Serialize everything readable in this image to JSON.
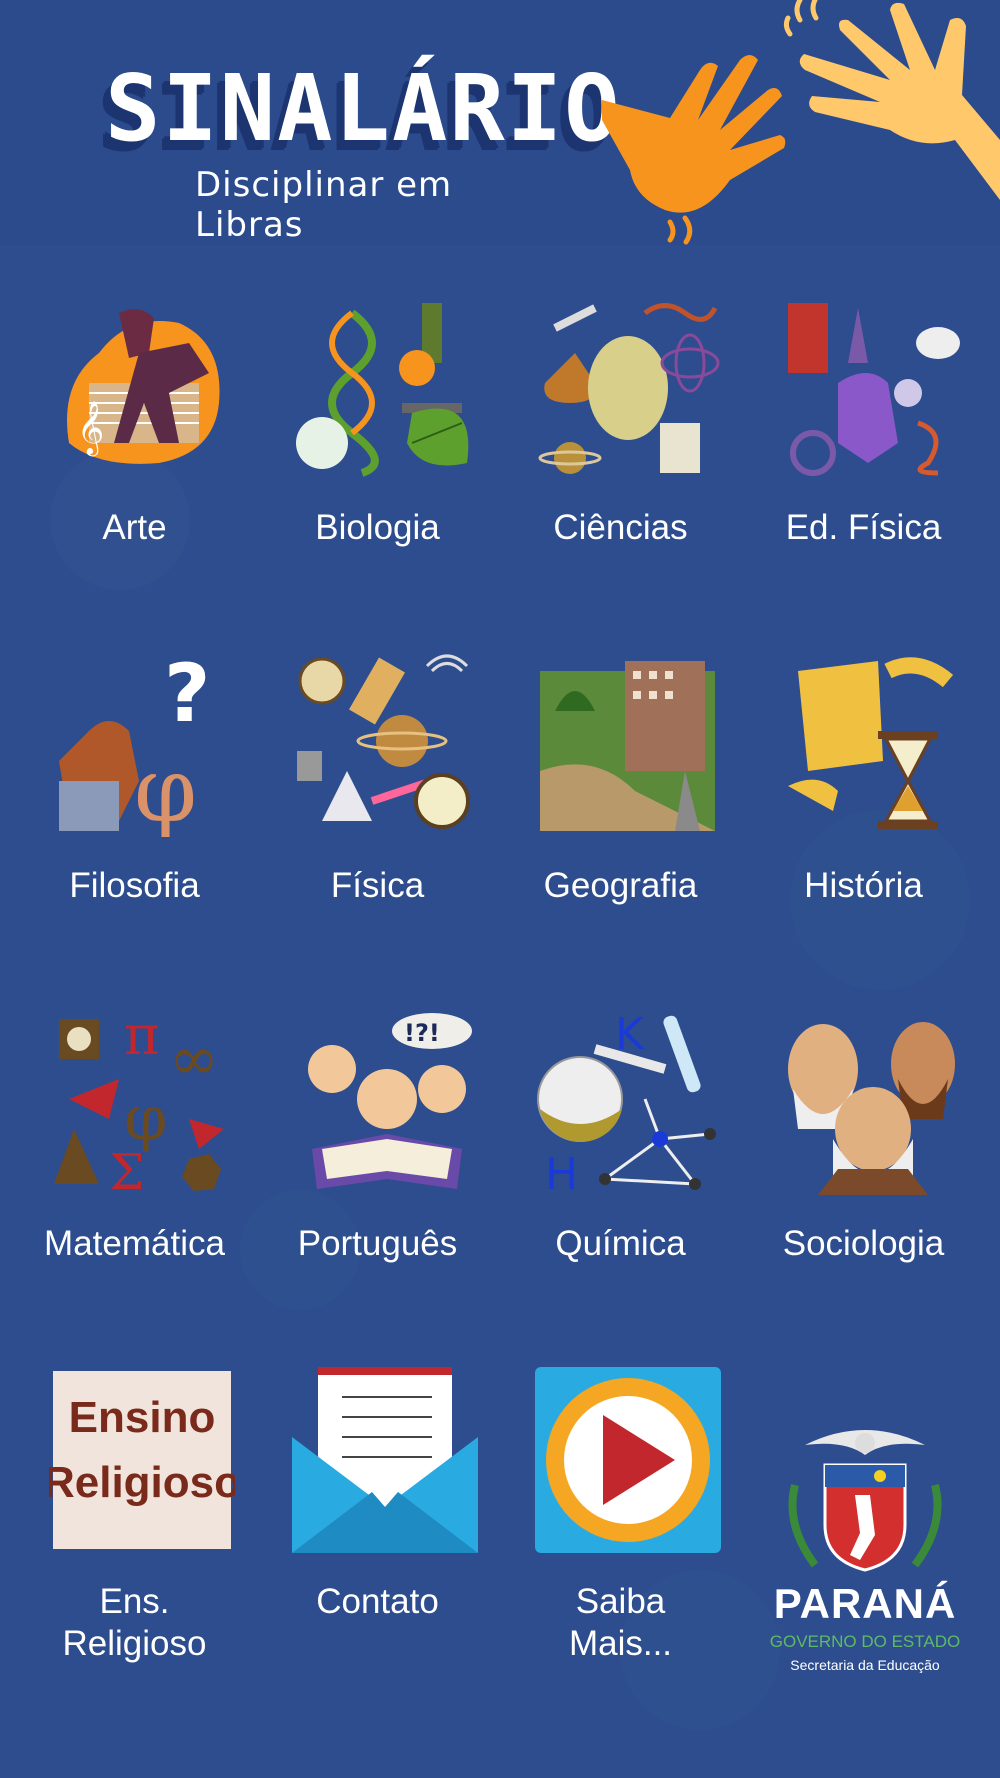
{
  "header": {
    "logo_title": "SINALÁRIO",
    "logo_subtitle": "Disciplinar em Libras"
  },
  "subjects": [
    {
      "label": "Arte",
      "icon": "arte-icon"
    },
    {
      "label": "Biologia",
      "icon": "biologia-icon"
    },
    {
      "label": "Ciências",
      "icon": "ciencias-icon"
    },
    {
      "label": "Ed. Física",
      "icon": "ed-fisica-icon"
    },
    {
      "label": "Filosofia",
      "icon": "filosofia-icon"
    },
    {
      "label": "Física",
      "icon": "fisica-icon"
    },
    {
      "label": "Geografia",
      "icon": "geografia-icon"
    },
    {
      "label": "História",
      "icon": "historia-icon"
    },
    {
      "label": "Matemática",
      "icon": "matematica-icon"
    },
    {
      "label": "Português",
      "icon": "portugues-icon"
    },
    {
      "label": "Química",
      "icon": "quimica-icon"
    },
    {
      "label": "Sociologia",
      "icon": "sociologia-icon"
    }
  ],
  "extras": {
    "ens_religioso": {
      "label_line1": "Ens.",
      "label_line2": "Religioso",
      "icon_text_line1": "Ensino",
      "icon_text_line2": "Religioso"
    },
    "contato": {
      "label": "Contato"
    },
    "saiba_mais": {
      "label_line1": "Saiba",
      "label_line2": "Mais..."
    }
  },
  "footer_seal": {
    "title": "PARANÁ",
    "line2": "GOVERNO DO ESTADO",
    "line3": "Secretaria da Educação"
  },
  "colors": {
    "background": "#2d4d8f",
    "hand_orange": "#f7941d",
    "hand_skin": "#ffc96b",
    "play_blue": "#29abe2",
    "play_red": "#c1272d"
  }
}
